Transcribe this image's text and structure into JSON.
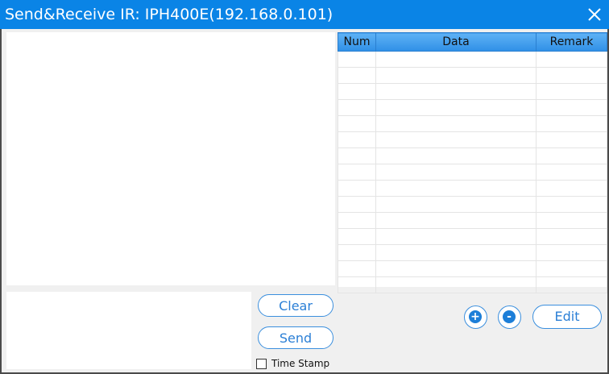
{
  "window": {
    "title": "Send&Receive IR: IPH400E(192.168.0.101)"
  },
  "table": {
    "columns": [
      "Num",
      "Data",
      "Remark"
    ],
    "rows": [
      [
        "",
        "",
        ""
      ],
      [
        "",
        "",
        ""
      ],
      [
        "",
        "",
        ""
      ],
      [
        "",
        "",
        ""
      ],
      [
        "",
        "",
        ""
      ],
      [
        "",
        "",
        ""
      ],
      [
        "",
        "",
        ""
      ],
      [
        "",
        "",
        ""
      ],
      [
        "",
        "",
        ""
      ],
      [
        "",
        "",
        ""
      ],
      [
        "",
        "",
        ""
      ],
      [
        "",
        "",
        ""
      ],
      [
        "",
        "",
        ""
      ],
      [
        "",
        "",
        ""
      ],
      [
        "",
        "",
        ""
      ]
    ]
  },
  "controls": {
    "clear_label": "Clear",
    "send_label": "Send",
    "edit_label": "Edit",
    "plus_label": "+",
    "minus_label": "-",
    "timestamp_label": "Time Stamp",
    "timestamp_checked": false
  },
  "colors": {
    "titlebar": "#0a84e6",
    "accent": "#3b8fde"
  }
}
